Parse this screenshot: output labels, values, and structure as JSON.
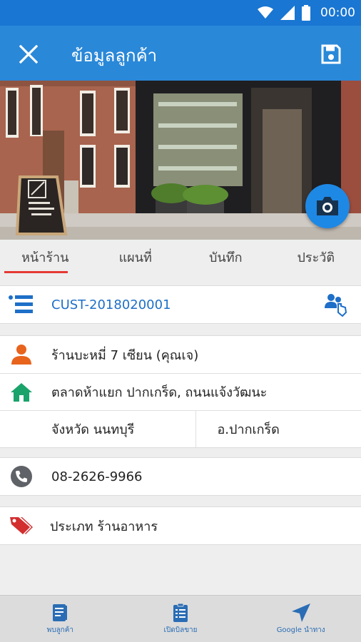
{
  "status_bar": {
    "time": "00:00"
  },
  "app_bar": {
    "title": "ข้อมูลลูกค้า"
  },
  "tabs": [
    {
      "label": "หน้าร้าน",
      "active": true
    },
    {
      "label": "แผนที่",
      "active": false
    },
    {
      "label": "บันทึก",
      "active": false
    },
    {
      "label": "ประวัติ",
      "active": false
    }
  ],
  "customer": {
    "code": "CUST-2018020001",
    "name": "ร้านบะหมี่ 7 เซียน (คุณเจ)",
    "address": "ตลาดห้าแยก ปากเกร็ด, ถนนแจ้งวัฒนะ",
    "province": "จังหวัด นนทบุรี",
    "district": "อ.ปากเกร็ด",
    "phone": "08-2626-9966",
    "category": "ประเภท ร้านอาหาร"
  },
  "bottom_nav": [
    {
      "label": "พบลูกค้า",
      "icon": "visit-customer-icon"
    },
    {
      "label": "เปิดบิลขาย",
      "icon": "sales-bill-icon"
    },
    {
      "label": "Google นำทาง",
      "icon": "navigation-icon"
    }
  ],
  "colors": {
    "app_bar": "#2a88d8",
    "status_bar": "#1976d2",
    "accent": "#e53935",
    "link": "#1e6fc8"
  }
}
